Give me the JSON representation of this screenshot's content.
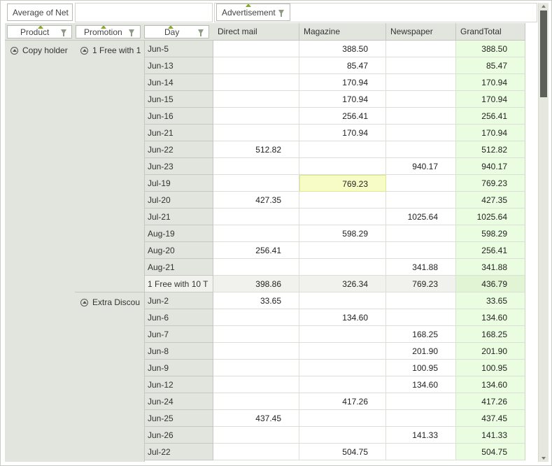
{
  "field_list": {
    "data_field": "Average of Net",
    "column_field": "Advertisement",
    "row_fields": [
      "Product",
      "Promotion",
      "Day"
    ]
  },
  "columns": [
    "Direct mail",
    "Magazine",
    "Newspaper",
    "GrandTotal"
  ],
  "groups": {
    "product": "Copy holder",
    "promo1": "1 Free with 1",
    "promo2": "Extra Discou"
  },
  "rows": [
    {
      "day": "Jun-5",
      "direct": "",
      "magazine": "388.50",
      "newspaper": "",
      "total": "388.50"
    },
    {
      "day": "Jun-13",
      "direct": "",
      "magazine": "85.47",
      "newspaper": "",
      "total": "85.47"
    },
    {
      "day": "Jun-14",
      "direct": "",
      "magazine": "170.94",
      "newspaper": "",
      "total": "170.94"
    },
    {
      "day": "Jun-15",
      "direct": "",
      "magazine": "170.94",
      "newspaper": "",
      "total": "170.94"
    },
    {
      "day": "Jun-16",
      "direct": "",
      "magazine": "256.41",
      "newspaper": "",
      "total": "256.41"
    },
    {
      "day": "Jun-21",
      "direct": "",
      "magazine": "170.94",
      "newspaper": "",
      "total": "170.94"
    },
    {
      "day": "Jun-22",
      "direct": "512.82",
      "magazine": "",
      "newspaper": "",
      "total": "512.82"
    },
    {
      "day": "Jun-23",
      "direct": "",
      "magazine": "",
      "newspaper": "940.17",
      "total": "940.17"
    },
    {
      "day": "Jul-19",
      "direct": "",
      "magazine": "769.23",
      "newspaper": "",
      "total": "769.23",
      "highlight": "magazine"
    },
    {
      "day": "Jul-20",
      "direct": "427.35",
      "magazine": "",
      "newspaper": "",
      "total": "427.35"
    },
    {
      "day": "Jul-21",
      "direct": "",
      "magazine": "",
      "newspaper": "1025.64",
      "total": "1025.64"
    },
    {
      "day": "Aug-19",
      "direct": "",
      "magazine": "598.29",
      "newspaper": "",
      "total": "598.29"
    },
    {
      "day": "Aug-20",
      "direct": "256.41",
      "magazine": "",
      "newspaper": "",
      "total": "256.41"
    },
    {
      "day": "Aug-21",
      "direct": "",
      "magazine": "",
      "newspaper": "341.88",
      "total": "341.88"
    },
    {
      "day": "1 Free with 10 T",
      "direct": "398.86",
      "magazine": "326.34",
      "newspaper": "769.23",
      "total": "436.79",
      "subtotal": true
    },
    {
      "day": "Jun-2",
      "direct": "33.65",
      "magazine": "",
      "newspaper": "",
      "total": "33.65"
    },
    {
      "day": "Jun-6",
      "direct": "",
      "magazine": "134.60",
      "newspaper": "",
      "total": "134.60"
    },
    {
      "day": "Jun-7",
      "direct": "",
      "magazine": "",
      "newspaper": "168.25",
      "total": "168.25"
    },
    {
      "day": "Jun-8",
      "direct": "",
      "magazine": "",
      "newspaper": "201.90",
      "total": "201.90"
    },
    {
      "day": "Jun-9",
      "direct": "",
      "magazine": "",
      "newspaper": "100.95",
      "total": "100.95"
    },
    {
      "day": "Jun-12",
      "direct": "",
      "magazine": "",
      "newspaper": "134.60",
      "total": "134.60"
    },
    {
      "day": "Jun-24",
      "direct": "",
      "magazine": "417.26",
      "newspaper": "",
      "total": "417.26"
    },
    {
      "day": "Jun-25",
      "direct": "437.45",
      "magazine": "",
      "newspaper": "",
      "total": "437.45"
    },
    {
      "day": "Jun-26",
      "direct": "",
      "magazine": "",
      "newspaper": "141.33",
      "total": "141.33"
    },
    {
      "day": "Jul-22",
      "direct": "",
      "magazine": "504.75",
      "newspaper": "",
      "total": "504.75"
    }
  ]
}
